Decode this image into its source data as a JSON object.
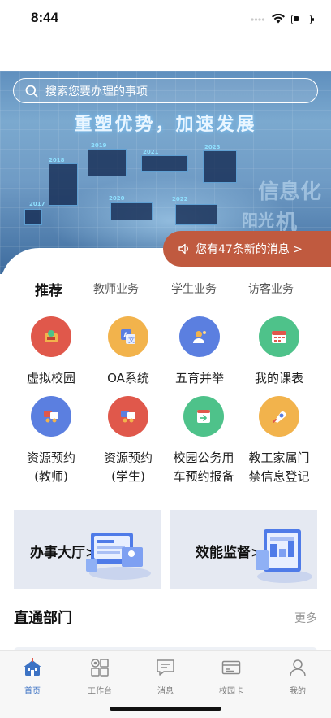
{
  "status": {
    "time": "8:44",
    "battery_level": 0.35
  },
  "search": {
    "placeholder": "搜索您要办理的事项"
  },
  "banner": {
    "title": "重塑优势，加速发展",
    "years": [
      "2016",
      "2017",
      "2018",
      "2019",
      "2020",
      "2021",
      "2022",
      "2023",
      "2024"
    ],
    "deco_words": [
      "信息化",
      "阳光",
      "机"
    ]
  },
  "messages": {
    "text": "您有47条新的消息 >"
  },
  "tabs": [
    "推荐",
    "教师业务",
    "学生业务",
    "访客业务"
  ],
  "grid": [
    {
      "label": "虚拟校园",
      "icon": "virtual-campus-icon",
      "color": "#e0584b"
    },
    {
      "label": "OA系统",
      "icon": "oa-system-icon",
      "color": "#f2b34c"
    },
    {
      "label": "五育并举",
      "icon": "five-education-icon",
      "color": "#5b7fe0"
    },
    {
      "label": "我的课表",
      "icon": "calendar-icon",
      "color": "#4ec28a"
    },
    {
      "label": "资源预约(教师)",
      "line1": "资源预约",
      "line2": "(教师)",
      "icon": "resource-booking-icon",
      "color": "#5b7fe0"
    },
    {
      "label": "资源预约(学生)",
      "line1": "资源预约",
      "line2": "(学生)",
      "icon": "resource-booking-icon",
      "color": "#e0584b"
    },
    {
      "label": "校园公务用车预约报备",
      "line1": "校园公务用",
      "line2": "车预约报备",
      "icon": "vehicle-booking-icon",
      "color": "#4ec28a"
    },
    {
      "label": "教工家属门禁信息登记",
      "line1": "教工家属门",
      "line2": "禁信息登记",
      "icon": "access-register-icon",
      "color": "#f2b34c"
    }
  ],
  "features": [
    {
      "label": "办事大厅>"
    },
    {
      "label": "效能监督>"
    }
  ],
  "section": {
    "title": "直通部门",
    "more": "更多"
  },
  "tabbar": [
    {
      "label": "首页",
      "icon": "home-icon",
      "active": true
    },
    {
      "label": "工作台",
      "icon": "workbench-icon",
      "active": false
    },
    {
      "label": "消息",
      "icon": "message-icon",
      "active": false
    },
    {
      "label": "校园卡",
      "icon": "campus-card-icon",
      "active": false
    },
    {
      "label": "我的",
      "icon": "profile-icon",
      "active": false
    }
  ],
  "colors": {
    "accent": "#3d73c4",
    "message_pill": "#c05a3f"
  }
}
